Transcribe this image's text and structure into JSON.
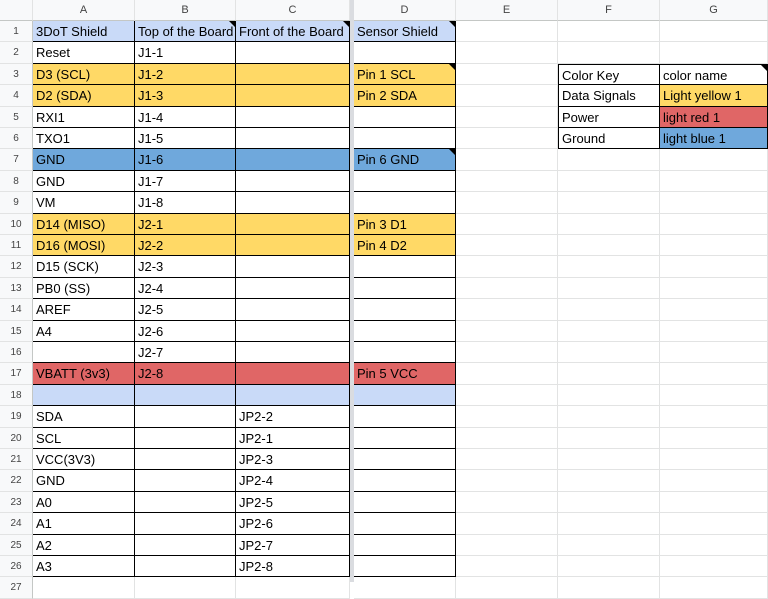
{
  "columns": [
    "A",
    "B",
    "C",
    "D",
    "E",
    "F",
    "G"
  ],
  "colors": {
    "header": "#c9daf8",
    "data": "#ffd966",
    "power": "#e06666",
    "ground": "#6fa8dc"
  },
  "rows": [
    {
      "cells": [
        "3DoT Shield",
        "Top of the Board",
        "Front of the Board",
        "Sensor Shield"
      ],
      "fill": "header",
      "notes": [
        1,
        2,
        3
      ]
    },
    {
      "cells": [
        "Reset",
        "J1-1",
        "",
        ""
      ]
    },
    {
      "cells": [
        "D3 (SCL)",
        "J1-2",
        "",
        "Pin 1 SCL"
      ],
      "fill": "data",
      "notes": [
        3
      ]
    },
    {
      "cells": [
        "D2 (SDA)",
        "J1-3",
        "",
        "Pin 2 SDA"
      ],
      "fill": "data"
    },
    {
      "cells": [
        "RXI1",
        "J1-4",
        "",
        ""
      ]
    },
    {
      "cells": [
        "TXO1",
        "J1-5",
        "",
        ""
      ]
    },
    {
      "cells": [
        "GND",
        "J1-6",
        "",
        "Pin 6 GND"
      ],
      "fill": "ground",
      "notes": [
        3
      ]
    },
    {
      "cells": [
        "GND",
        "J1-7",
        "",
        ""
      ]
    },
    {
      "cells": [
        "VM",
        "J1-8",
        "",
        ""
      ]
    },
    {
      "cells": [
        "D14 (MISO)",
        "J2-1",
        "",
        "Pin 3 D1"
      ],
      "fill": "data"
    },
    {
      "cells": [
        "D16 (MOSI)",
        "J2-2",
        "",
        "Pin 4 D2"
      ],
      "fill": "data"
    },
    {
      "cells": [
        "D15 (SCK)",
        "J2-3",
        "",
        ""
      ]
    },
    {
      "cells": [
        "PB0 (SS)",
        "J2-4",
        "",
        ""
      ]
    },
    {
      "cells": [
        "AREF",
        "J2-5",
        "",
        ""
      ]
    },
    {
      "cells": [
        "A4",
        "J2-6",
        "",
        ""
      ]
    },
    {
      "cells": [
        "",
        "J2-7",
        "",
        ""
      ]
    },
    {
      "cells": [
        "VBATT (3v3)",
        "J2-8",
        "",
        "Pin 5 VCC"
      ],
      "fill": "power"
    },
    {
      "cells": [
        "",
        "",
        "",
        ""
      ],
      "fill": "header"
    },
    {
      "cells": [
        "SDA",
        "",
        "JP2-2",
        ""
      ]
    },
    {
      "cells": [
        "SCL",
        "",
        "JP2-1",
        ""
      ]
    },
    {
      "cells": [
        "VCC(3V3)",
        "",
        "JP2-3",
        ""
      ]
    },
    {
      "cells": [
        "GND",
        "",
        "JP2-4",
        ""
      ]
    },
    {
      "cells": [
        "A0",
        "",
        "JP2-5",
        ""
      ]
    },
    {
      "cells": [
        "A1",
        "",
        "JP2-6",
        ""
      ]
    },
    {
      "cells": [
        "A2",
        "",
        "JP2-7",
        ""
      ]
    },
    {
      "cells": [
        "A3",
        "",
        "JP2-8",
        ""
      ]
    }
  ],
  "color_key": [
    {
      "label": "Color Key",
      "value": "color name",
      "fill": ""
    },
    {
      "label": "Data Signals",
      "value": "Light yellow 1",
      "fill": "data"
    },
    {
      "label": "Power",
      "value": "light red 1",
      "fill": "power"
    },
    {
      "label": "Ground",
      "value": "light blue 1",
      "fill": "ground"
    }
  ]
}
